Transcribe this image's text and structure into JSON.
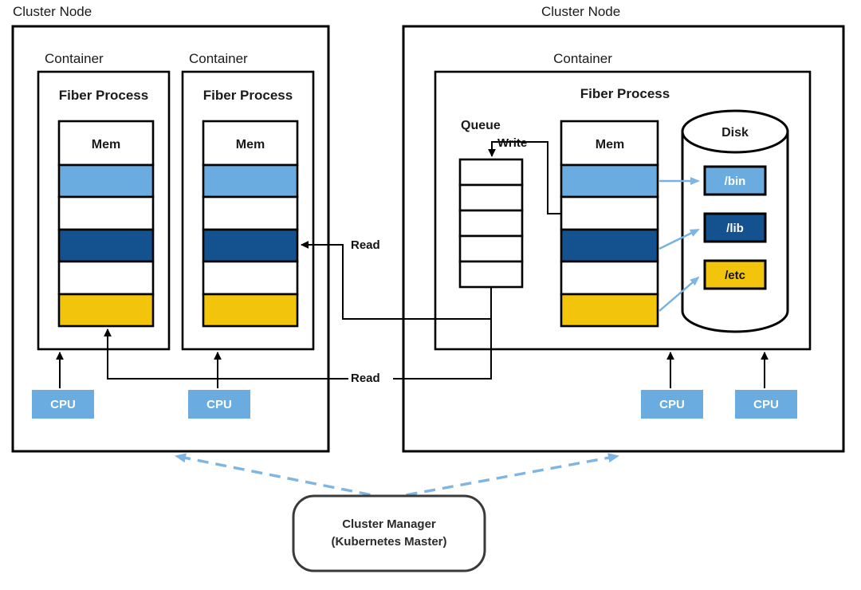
{
  "diagram": {
    "title_left_node": "Cluster Node",
    "title_right_node": "Cluster Node",
    "colors": {
      "light_blue": "#6AABE0",
      "dark_blue": "#14518F",
      "yellow": "#F2C40C",
      "arrow_blue": "#7FB5E3",
      "outline": "#000000",
      "white": "#FFFFFF"
    }
  },
  "left_node": {
    "label": "Cluster Node",
    "containers": [
      {
        "label": "Container",
        "process": {
          "label": "Fiber Process",
          "mem": {
            "label": "Mem",
            "cells": [
              "light_blue",
              "white",
              "dark_blue",
              "white",
              "yellow"
            ]
          }
        }
      },
      {
        "label": "Container",
        "process": {
          "label": "Fiber Process",
          "mem": {
            "label": "Mem",
            "cells": [
              "light_blue",
              "white",
              "dark_blue",
              "white",
              "yellow"
            ]
          }
        }
      }
    ],
    "cpus": [
      {
        "label": "CPU"
      },
      {
        "label": "CPU"
      }
    ]
  },
  "right_node": {
    "label": "Cluster Node",
    "container": {
      "label": "Container",
      "process": {
        "label": "Fiber Process",
        "queue": {
          "label": "Queue",
          "cell_count": 5
        },
        "mem": {
          "label": "Mem",
          "cells": [
            "light_blue",
            "white",
            "dark_blue",
            "white",
            "yellow"
          ]
        },
        "disk": {
          "label": "Disk",
          "partitions": [
            {
              "label": "/bin",
              "color": "light_blue",
              "text_color": "#FFFFFF"
            },
            {
              "label": "/lib",
              "color": "dark_blue",
              "text_color": "#FFFFFF"
            },
            {
              "label": "/etc",
              "color": "yellow",
              "text_color": "#111111"
            }
          ]
        }
      }
    },
    "cpus": [
      {
        "label": "CPU"
      },
      {
        "label": "CPU"
      }
    ]
  },
  "edges": {
    "write_label": "Write",
    "read_label_upper": "Read",
    "read_label_lower": "Read"
  },
  "cluster_manager": {
    "line1": "Cluster Manager",
    "line2": "(Kubernetes Master)"
  }
}
